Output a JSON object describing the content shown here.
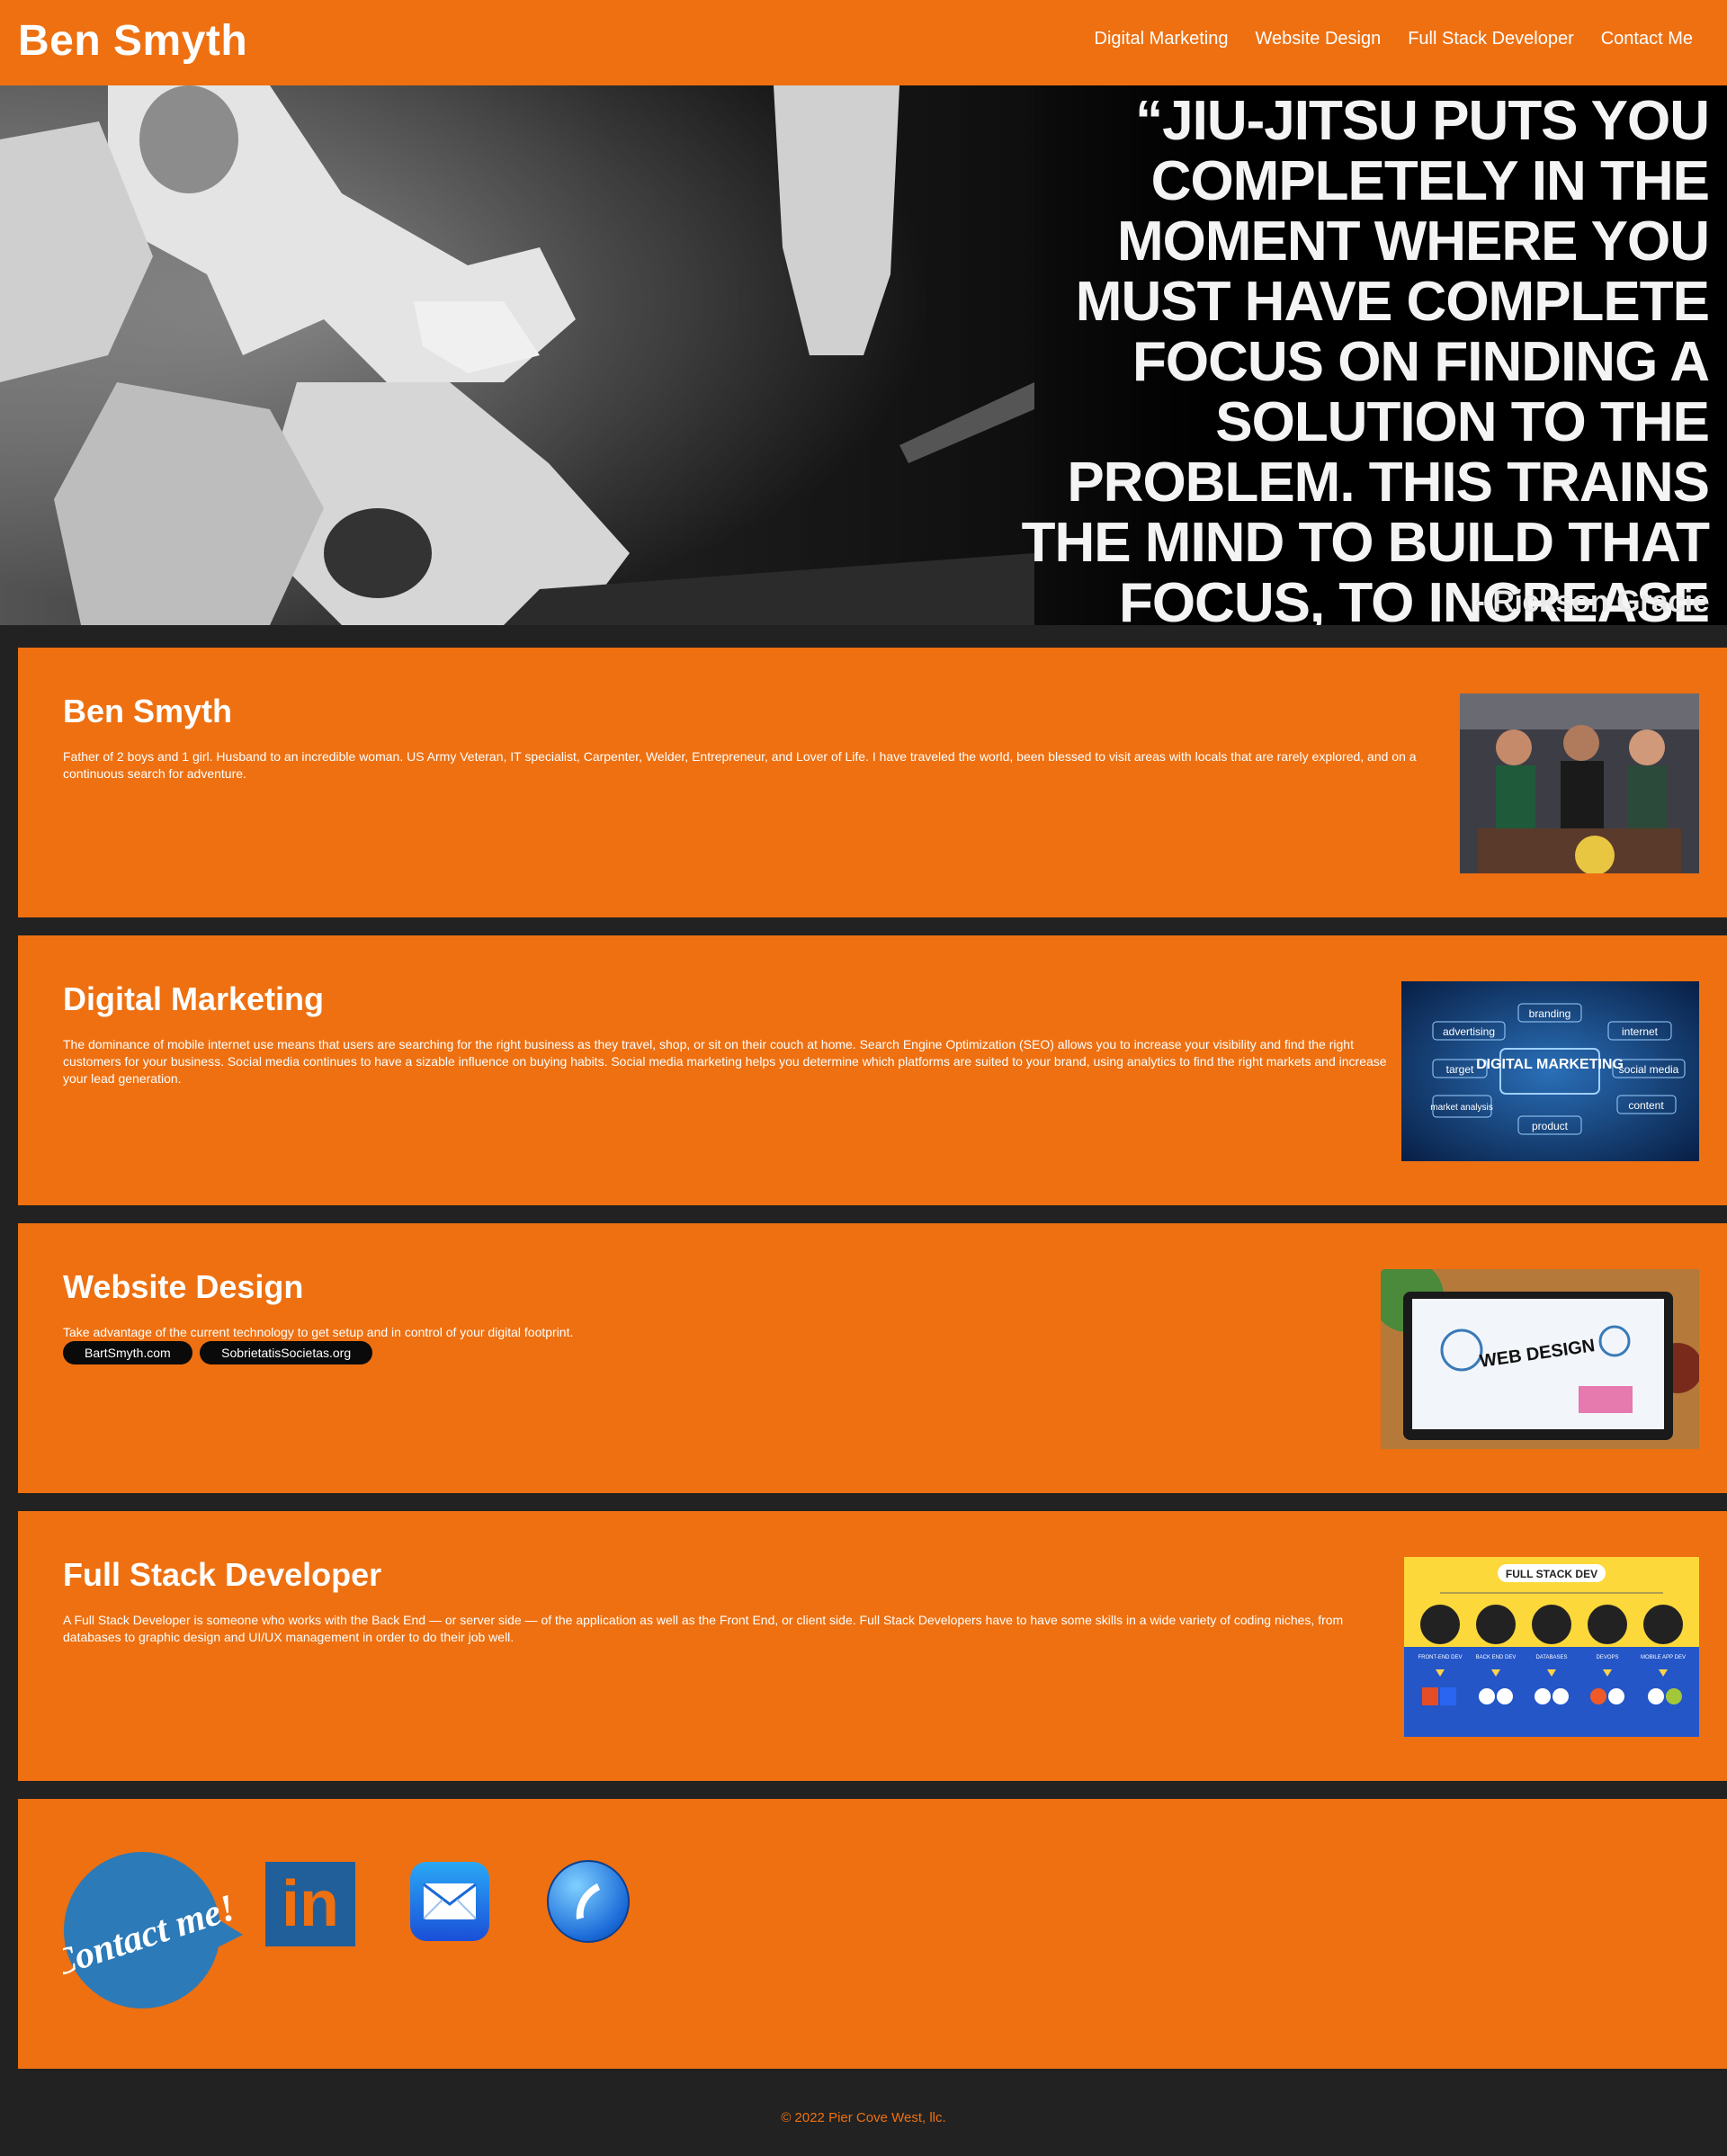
{
  "header": {
    "brand": "Ben Smyth",
    "nav": [
      "Digital Marketing",
      "Website Design",
      "Full Stack Developer",
      "Contact Me"
    ]
  },
  "hero": {
    "quote": "“Jiu-Jitsu puts you completely in the moment where you must have complete focus on finding a solution to the problem. This trains the mind to build that focus, to increase your awareness, your capacity to solve problems.”",
    "author": "- Rickson Gracie"
  },
  "about": {
    "title": "Ben Smyth",
    "text": "Father of 2 boys and 1 girl. Husband to an incredible woman. US Army Veteran, IT specialist, Carpenter, Welder, Entrepreneur, and Lover of Life. I have traveled the world, been blessed to visit areas with locals that are rarely explored, and on a continuous search for adventure."
  },
  "marketing": {
    "title": "Digital Marketing",
    "text": "The dominance of mobile internet use means that users are searching for the right business as they travel, shop, or sit on their couch at home. Search Engine Optimization (SEO) allows you to increase your visibility and find the right customers for your business. Social media continues to have a sizable influence on buying habits. Social media marketing helps you determine which platforms are suited to your brand, using analytics to find the right markets and increase your lead generation.",
    "image_labels": {
      "center": "DIGITAL MARKETING",
      "branding": "branding",
      "advertising": "advertising",
      "internet": "internet",
      "target": "target",
      "social": "social media",
      "market": "market analysis",
      "content": "content",
      "product": "product"
    }
  },
  "web": {
    "title": "Website Design",
    "text": "Take advantage of the current technology to get setup and in control of your digital footprint.",
    "links": [
      "BartSmyth.com",
      "SobrietatisSocietas.org"
    ],
    "image_label": "WEB DESIGN"
  },
  "fullstack": {
    "title": "Full Stack Developer",
    "text": "A Full Stack Developer is someone who works with the Back End — or server side — of the application as well as the Front End, or client side. Full Stack Developers have to have some skills in a wide variety of coding niches, from databases to graphic design and UI/UX management in order to do their job well.",
    "image_title": "FULL STACK DEV",
    "image_cols": [
      "FRONT-END DEV",
      "BACK END DEV",
      "DATABASES",
      "DEVOPS",
      "MOBILE APP DEV"
    ]
  },
  "contact": {
    "bubble": "Contact me!",
    "linkedin": "in"
  },
  "footer": {
    "copyright": "© 2022 Pier Cove West, llc."
  },
  "colors": {
    "orange": "#ee7011",
    "dark": "#222222"
  }
}
